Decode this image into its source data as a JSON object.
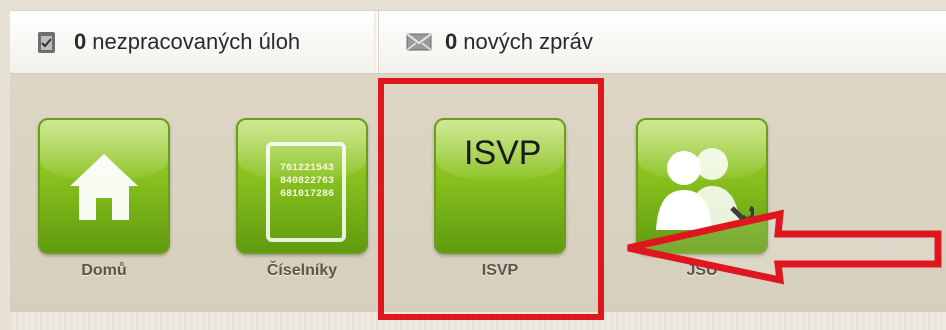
{
  "header": {
    "tasks": {
      "count": "0",
      "label": "nezpracovaných úloh"
    },
    "messages": {
      "count": "0",
      "label": "nových zpráv"
    }
  },
  "tiles": [
    {
      "label": "Domů",
      "icon": "home-icon"
    },
    {
      "label": "Číselníky",
      "icon": "codebook-icon",
      "numbers": [
        "761221543",
        "840822763",
        "681017286"
      ]
    },
    {
      "label": "ISVP",
      "icon": "isvp-icon",
      "text": "ISVP"
    },
    {
      "label": "JSU",
      "icon": "users-wrench-icon"
    }
  ],
  "annotation": {
    "highlight_color": "#e0161e",
    "arrow_color": "#e0161e"
  }
}
